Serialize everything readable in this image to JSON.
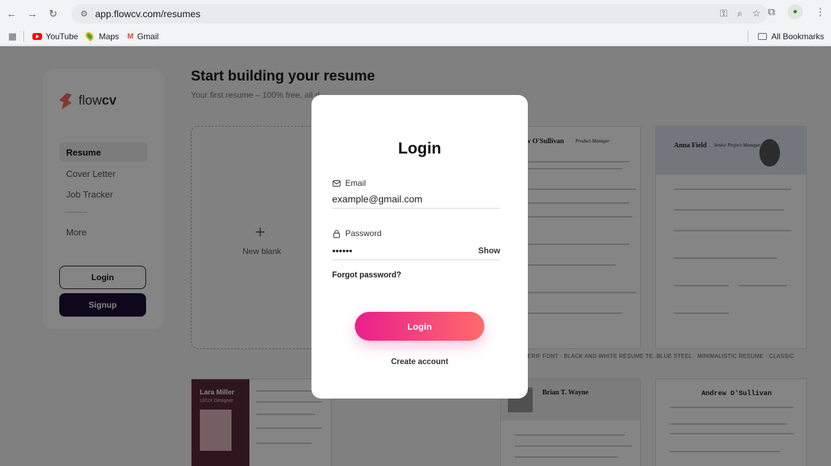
{
  "browser": {
    "url": "app.flowcv.com/resumes",
    "bookmarks": [
      "YouTube",
      "Maps",
      "Gmail"
    ],
    "all_bookmarks": "All Bookmarks"
  },
  "sidebar": {
    "brand": "flow",
    "brand_bold": "cv",
    "items": [
      "Resume",
      "Cover Letter",
      "Job Tracker",
      "More"
    ],
    "login": "Login",
    "signup": "Signup"
  },
  "main": {
    "title": "Start building your resume",
    "subtitle": "Your first resume – 100% free, all d",
    "new_blank": "New blank",
    "templates": [
      {
        "name": "w O'Sullivan",
        "role": "Product Manager"
      },
      {
        "name": "Anna Field",
        "role": "Senior Project Manager"
      },
      {
        "name": "Lara Miller",
        "role": "UI/UX Designer"
      },
      {
        "name": "Brian T. Wayne",
        "role": ""
      },
      {
        "name": "Andrew O'Sullivan",
        "role": ""
      }
    ],
    "captions": [
      "SERIF FONT · BLACK AND WHITE RESUME TE...",
      "BLUE STEEL · MINIMALISTIC RESUME · CLASSIC"
    ]
  },
  "modal": {
    "title": "Login",
    "email_label": "Email",
    "email_value": "example@gmail.com",
    "password_label": "Password",
    "password_value": "••••••",
    "show": "Show",
    "forgot": "Forgot password?",
    "login_button": "Login",
    "create_account": "Create account"
  },
  "colors": {
    "login_gradient_start": "#e91e8c",
    "login_gradient_end": "#ff6b6b",
    "signup_bg": "#1a1035"
  }
}
